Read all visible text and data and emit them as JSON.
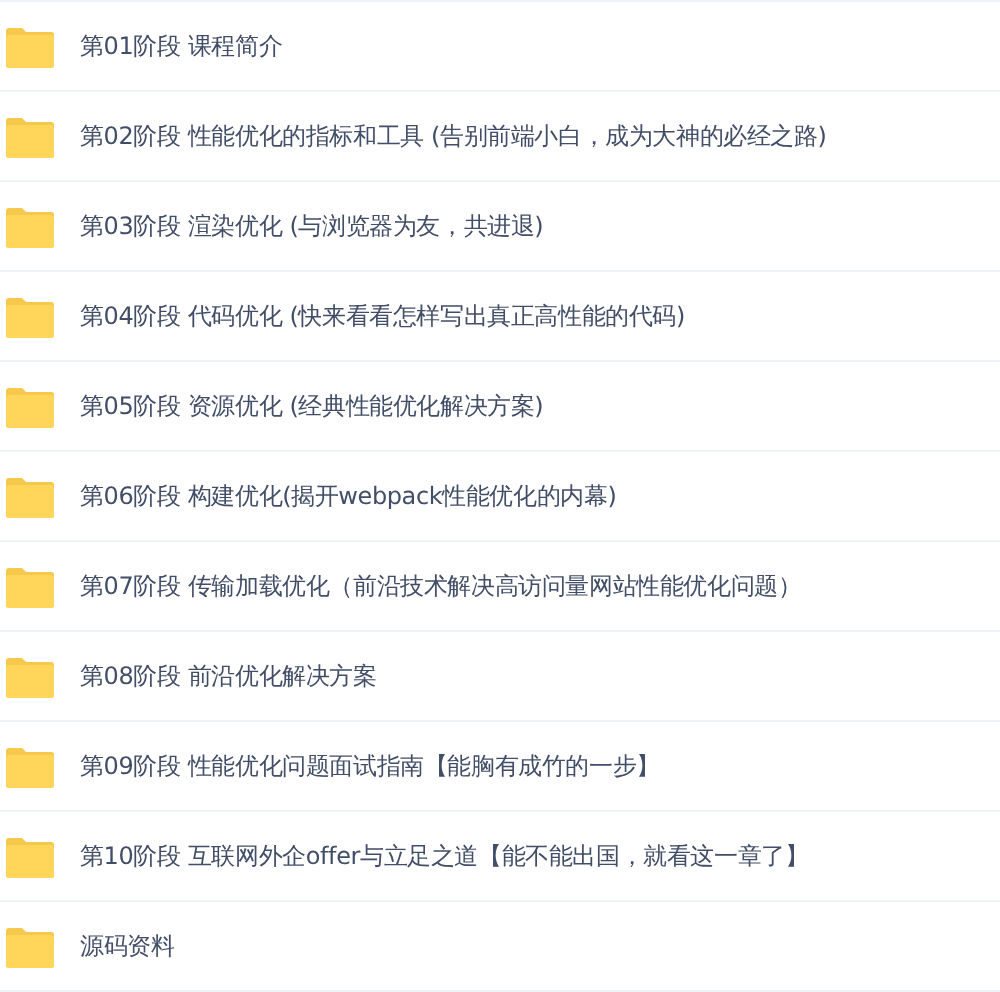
{
  "folders": [
    {
      "name": "第01阶段 课程简介"
    },
    {
      "name": "第02阶段 性能优化的指标和工具 (告别前端小白，成为大神的必经之路)"
    },
    {
      "name": "第03阶段 渲染优化 (与浏览器为友，共进退)"
    },
    {
      "name": "第04阶段 代码优化 (快来看看怎样写出真正高性能的代码)"
    },
    {
      "name": "第05阶段 资源优化 (经典性能优化解决方案)"
    },
    {
      "name": "第06阶段 构建优化(揭开webpack性能优化的内幕)"
    },
    {
      "name": "第07阶段 传输加载优化（前沿技术解决高访问量网站性能优化问题）"
    },
    {
      "name": "第08阶段 前沿优化解决方案"
    },
    {
      "name": "第09阶段 性能优化问题面试指南【能胸有成竹的一步】"
    },
    {
      "name": "第10阶段 互联网外企offer与立足之道【能不能出国，就看这一章了】"
    },
    {
      "name": "源码资料"
    }
  ]
}
